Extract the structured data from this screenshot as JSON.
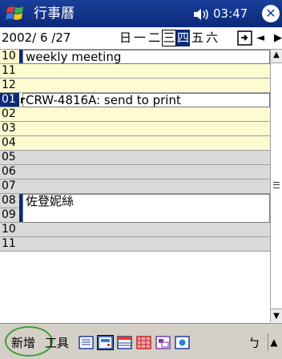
{
  "titlebar": {
    "app_title": "行事曆",
    "time": "03:47",
    "start_icon": "windows-flag-icon",
    "volume_icon": "speaker-icon",
    "close_icon": "close-icon"
  },
  "datebar": {
    "date": "2002/ 6 /27",
    "weekdays": [
      "日",
      "一",
      "二",
      "三",
      "四",
      "五",
      "六"
    ],
    "today_index": 3,
    "selected_index": 4,
    "goto_icon": "goto-today-icon",
    "prev_label": "◄",
    "next_label": "▶"
  },
  "agenda": {
    "rows": [
      {
        "hour": "10",
        "kind": "work"
      },
      {
        "hour": "11",
        "kind": "work"
      },
      {
        "hour": "12",
        "kind": "work"
      },
      {
        "hour": "01",
        "kind": "work",
        "highlight": true
      },
      {
        "hour": "02",
        "kind": "work"
      },
      {
        "hour": "03",
        "kind": "work"
      },
      {
        "hour": "04",
        "kind": "work"
      },
      {
        "hour": "05",
        "kind": "off"
      },
      {
        "hour": "06",
        "kind": "off"
      },
      {
        "hour": "07",
        "kind": "off"
      },
      {
        "hour": "08",
        "kind": "off"
      },
      {
        "hour": "09",
        "kind": "off"
      },
      {
        "hour": "10",
        "kind": "off"
      },
      {
        "hour": "11",
        "kind": "off"
      }
    ],
    "appointments": [
      {
        "text": "weekly meeting"
      },
      {
        "text": "CRW-4816A: send to print"
      },
      {
        "text": "佐登妮絲"
      }
    ]
  },
  "cmdbar": {
    "new_label": "新增",
    "tools_label": "工具",
    "view_icons": [
      "agenda-view-icon",
      "day-view-icon",
      "week-view-icon",
      "month-view-icon",
      "year-view-icon",
      "today-view-icon"
    ],
    "active_view_index": 1,
    "keyboard_label": "ㄅ",
    "input_up_label": "▲"
  },
  "colors": {
    "title_bg": "#0b2a7a",
    "work_hours": "#fdfbd0",
    "off_hours": "#d9d9d9",
    "highlight_ring": "#3aa035"
  }
}
